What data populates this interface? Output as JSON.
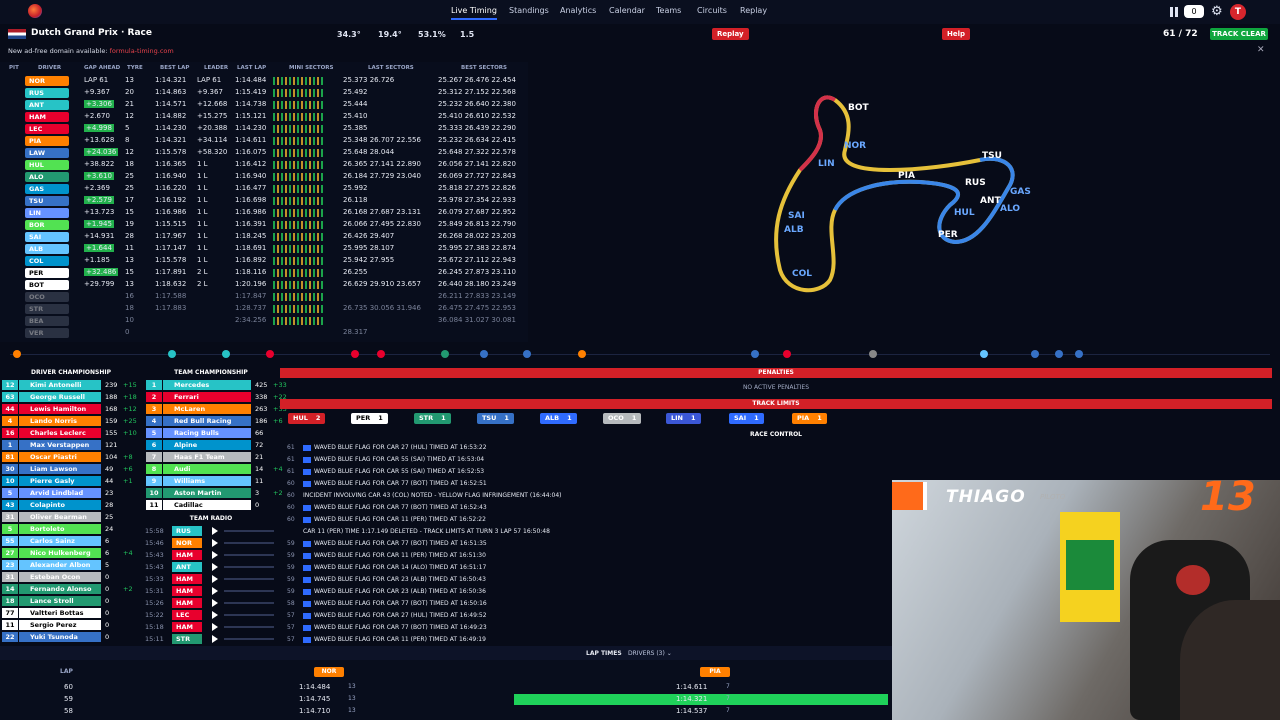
{
  "nav": {
    "items": [
      "Live Timing",
      "Standings",
      "Analytics",
      "Calendar",
      "Teams",
      "Circuits",
      "Replay"
    ],
    "notif_count": "0",
    "avatar_letter": "T"
  },
  "session": {
    "title": "Dutch Grand Prix · Race",
    "track_temp": "34.3°",
    "air_temp": "19.4°",
    "humidity": "53.1%",
    "wind": "1.5",
    "replay_label": "Replay",
    "help_label": "Help",
    "laps": "61 / 72",
    "status": "TRACK CLEAR",
    "ad_notice": "New ad-free domain available:",
    "ad_link": "formula-timing.com"
  },
  "timing_headers": [
    "PIT",
    "DRIVER",
    "GAP AHEAD",
    "TYRE",
    "BEST LAP",
    "LEADER",
    "LAST LAP",
    "MINI SECTORS",
    "LAST SECTORS",
    "BEST SECTORS"
  ],
  "timing_rows": [
    {
      "pos": "1",
      "code": "NOR",
      "color": "#ff8000",
      "gap": "LAP 61",
      "tyre": "13",
      "best": "1:14.321",
      "leader": "LAP 61",
      "last": "1:14.484",
      "ls": "25.373 26.726",
      "bs": "25.267 26.476 22.454"
    },
    {
      "pos": "2",
      "code": "RUS",
      "color": "#27c3c6",
      "gap": "+9.367",
      "tyre": "20",
      "best": "1:14.863",
      "leader": "+9.367",
      "last": "1:15.419",
      "ls": "25.492",
      "bs": "25.312 27.152 22.568"
    },
    {
      "pos": "3",
      "code": "ANT",
      "color": "#27c3c6",
      "gap": "+3.306",
      "tyre": "21",
      "best": "1:14.571",
      "leader": "+12.668",
      "last": "1:14.738",
      "ls": "25.444",
      "bs": "25.232 26.640 22.380"
    },
    {
      "pos": "4",
      "code": "HAM",
      "color": "#e8002d",
      "gap": "+2.670",
      "tyre": "12",
      "best": "1:14.882",
      "leader": "+15.275",
      "last": "1:15.121",
      "ls": "25.410",
      "bs": "25.410 26.610 22.532"
    },
    {
      "pos": "5",
      "code": "LEC",
      "color": "#e8002d",
      "gap": "+4.998",
      "tyre": "5",
      "best": "1:14.230",
      "leader": "+20.388",
      "last": "1:14.230",
      "ls": "25.385",
      "bs": "25.333 26.439 22.290"
    },
    {
      "pos": "6",
      "code": "PIA",
      "color": "#ff8000",
      "gap": "+13.628",
      "tyre": "8",
      "best": "1:14.321",
      "leader": "+34.114",
      "last": "1:14.611",
      "ls": "25.348 26.707 22.556",
      "bs": "25.232 26.634 22.415"
    },
    {
      "pos": "7",
      "code": "LAW",
      "color": "#3671c6",
      "gap": "+24.036",
      "tyre": "12",
      "best": "1:15.578",
      "leader": "+58.320",
      "last": "1:16.075",
      "ls": "25.648 28.044",
      "bs": "25.648 27.322 22.578"
    },
    {
      "pos": "8",
      "code": "HUL",
      "color": "#52e252",
      "gap": "+38.822",
      "tyre": "18",
      "best": "1:16.365",
      "leader": "1 L",
      "last": "1:16.412",
      "ls": "26.365 27.141 22.890",
      "bs": "26.056 27.141 22.820"
    },
    {
      "pos": "9",
      "code": "ALO",
      "color": "#229971",
      "gap": "+3.610",
      "tyre": "25",
      "best": "1:16.940",
      "leader": "1 L",
      "last": "1:16.940",
      "ls": "26.184 27.729 23.040",
      "bs": "26.069 27.727 22.843"
    },
    {
      "pos": "10",
      "code": "GAS",
      "color": "#0093cc",
      "gap": "+2.369",
      "tyre": "25",
      "best": "1:16.220",
      "leader": "1 L",
      "last": "1:16.477",
      "ls": "25.992",
      "bs": "25.818 27.275 22.826"
    },
    {
      "pos": "11",
      "code": "TSU",
      "color": "#3671c6",
      "gap": "+2.579",
      "tyre": "17",
      "best": "1:16.192",
      "leader": "1 L",
      "last": "1:16.698",
      "ls": "26.118",
      "bs": "25.978 27.354 22.933"
    },
    {
      "pos": "12",
      "code": "LIN",
      "color": "#6692ff",
      "gap": "+13.723",
      "tyre": "15",
      "best": "1:16.986",
      "leader": "1 L",
      "last": "1:16.986",
      "ls": "26.168 27.687 23.131",
      "bs": "26.079 27.687 22.952"
    },
    {
      "pos": "13",
      "code": "BOR",
      "color": "#52e252",
      "gap": "+1.945",
      "tyre": "19",
      "best": "1:15.515",
      "leader": "1 L",
      "last": "1:16.391",
      "ls": "26.066 27.495 22.830",
      "bs": "25.849 26.813 22.790"
    },
    {
      "pos": "14",
      "code": "SAI",
      "color": "#64c4ff",
      "gap": "+14.931",
      "tyre": "28",
      "best": "1:17.967",
      "leader": "1 L",
      "last": "1:18.245",
      "ls": "26.426 29.407",
      "bs": "26.268 28.022 23.203"
    },
    {
      "pos": "15",
      "code": "ALB",
      "color": "#64c4ff",
      "gap": "+1.644",
      "tyre": "11",
      "best": "1:17.147",
      "leader": "1 L",
      "last": "1:18.691",
      "ls": "25.995 28.107",
      "bs": "25.995 27.383 22.874"
    },
    {
      "pos": "16",
      "code": "COL",
      "color": "#0093cc",
      "gap": "+1.185",
      "tyre": "13",
      "best": "1:15.578",
      "leader": "1 L",
      "last": "1:16.892",
      "ls": "25.942 27.955",
      "bs": "25.672 27.112 22.943"
    },
    {
      "pos": "17",
      "code": "PER",
      "color": "#ffffff",
      "gap": "+32.486",
      "tyre": "15",
      "best": "1:17.891",
      "leader": "2 L",
      "last": "1:18.116",
      "ls": "26.255",
      "bs": "26.245 27.873 23.110"
    },
    {
      "pos": "18",
      "code": "BOT",
      "color": "#ffffff",
      "gap": "+29.799",
      "tyre": "13",
      "best": "1:18.632",
      "leader": "2 L",
      "last": "1:20.196",
      "ls": "26.629 29.910 23.657",
      "bs": "26.440 28.180 23.249"
    },
    {
      "pos": "19",
      "code": "OCO",
      "color": "#555d72",
      "gap": "",
      "tyre": "16",
      "best": "1:17.588",
      "leader": "",
      "last": "1:17.847",
      "ls": "",
      "bs": "26.211 27.833 23.149"
    },
    {
      "pos": "20",
      "code": "STR",
      "color": "#555d72",
      "gap": "",
      "tyre": "18",
      "best": "1:17.883",
      "leader": "",
      "last": "1:28.737",
      "ls": "26.735 30.056 31.946",
      "bs": "26.475 27.475 22.953"
    },
    {
      "pos": "21",
      "code": "BEA",
      "color": "#555d72",
      "gap": "",
      "tyre": "10",
      "best": "",
      "leader": "",
      "last": "2:34.256",
      "ls": "",
      "bs": "36.084 31.027 30.081"
    },
    {
      "pos": "22",
      "code": "VER",
      "color": "#555d72",
      "gap": "",
      "tyre": "0",
      "best": "",
      "leader": "",
      "last": "",
      "ls": "28.317",
      "bs": ""
    }
  ],
  "map_labels": [
    "BOT",
    "LIN",
    "NOR",
    "TSU",
    "PIA",
    "RUS",
    "GAS",
    "ANT",
    "ALO",
    "SAI",
    "ALB",
    "HUL",
    "PER",
    "COL"
  ],
  "driver_champ": {
    "title": "DRIVER CHAMPIONSHIP",
    "rows": [
      {
        "num": "12",
        "name": "Kimi Antonelli",
        "pts": "239",
        "delta": "+15",
        "color": "#27c3c6"
      },
      {
        "num": "63",
        "name": "George Russell",
        "pts": "188",
        "delta": "+18",
        "color": "#27c3c6"
      },
      {
        "num": "44",
        "name": "Lewis Hamilton",
        "pts": "168",
        "delta": "+12",
        "color": "#e8002d"
      },
      {
        "num": "4",
        "name": "Lando Norris",
        "pts": "159",
        "delta": "+25",
        "color": "#ff8000"
      },
      {
        "num": "16",
        "name": "Charles Leclerc",
        "pts": "155",
        "delta": "+10",
        "color": "#e8002d"
      },
      {
        "num": "1",
        "name": "Max Verstappen",
        "pts": "121",
        "delta": "",
        "color": "#3671c6"
      },
      {
        "num": "81",
        "name": "Oscar Piastri",
        "pts": "104",
        "delta": "+8",
        "color": "#ff8000"
      },
      {
        "num": "30",
        "name": "Liam Lawson",
        "pts": "49",
        "delta": "+6",
        "color": "#3671c6"
      },
      {
        "num": "10",
        "name": "Pierre Gasly",
        "pts": "44",
        "delta": "+1",
        "color": "#0093cc"
      },
      {
        "num": "5",
        "name": "Arvid Lindblad",
        "pts": "23",
        "delta": "",
        "color": "#6692ff"
      },
      {
        "num": "43",
        "name": "Colapinto",
        "pts": "28",
        "delta": "",
        "color": "#0093cc"
      },
      {
        "num": "31",
        "name": "Oliver Bearman",
        "pts": "25",
        "delta": "",
        "color": "#b6babd"
      },
      {
        "num": "5",
        "name": "Bortoleto",
        "pts": "24",
        "delta": "",
        "color": "#52e252"
      },
      {
        "num": "55",
        "name": "Carlos Sainz",
        "pts": "6",
        "delta": "",
        "color": "#64c4ff"
      },
      {
        "num": "27",
        "name": "Nico Hulkenberg",
        "pts": "6",
        "delta": "+4",
        "color": "#52e252"
      },
      {
        "num": "23",
        "name": "Alexander Albon",
        "pts": "5",
        "delta": "",
        "color": "#64c4ff"
      },
      {
        "num": "31",
        "name": "Esteban Ocon",
        "pts": "0",
        "delta": "",
        "color": "#b6babd"
      },
      {
        "num": "14",
        "name": "Fernando Alonso",
        "pts": "0",
        "delta": "+2",
        "color": "#229971"
      },
      {
        "num": "18",
        "name": "Lance Stroll",
        "pts": "0",
        "delta": "",
        "color": "#229971"
      },
      {
        "num": "77",
        "name": "Valtteri Bottas",
        "pts": "0",
        "delta": "",
        "color": "#ffffff"
      },
      {
        "num": "11",
        "name": "Sergio Perez",
        "pts": "0",
        "delta": "",
        "color": "#ffffff"
      },
      {
        "num": "22",
        "name": "Yuki Tsunoda",
        "pts": "0",
        "delta": "",
        "color": "#3671c6"
      }
    ]
  },
  "team_champ": {
    "title": "TEAM CHAMPIONSHIP",
    "rows": [
      {
        "num": "1",
        "name": "Mercedes",
        "pts": "425",
        "delta": "+33",
        "color": "#27c3c6"
      },
      {
        "num": "2",
        "name": "Ferrari",
        "pts": "338",
        "delta": "+22",
        "color": "#e8002d"
      },
      {
        "num": "3",
        "name": "McLaren",
        "pts": "263",
        "delta": "+33",
        "color": "#ff8000"
      },
      {
        "num": "4",
        "name": "Red Bull Racing",
        "pts": "186",
        "delta": "+6",
        "color": "#3671c6"
      },
      {
        "num": "5",
        "name": "Racing Bulls",
        "pts": "66",
        "delta": "",
        "color": "#6692ff"
      },
      {
        "num": "6",
        "name": "Alpine",
        "pts": "72",
        "delta": "",
        "color": "#0093cc"
      },
      {
        "num": "7",
        "name": "Haas F1 Team",
        "pts": "21",
        "delta": "",
        "color": "#b6babd"
      },
      {
        "num": "8",
        "name": "Audi",
        "pts": "14",
        "delta": "+4",
        "color": "#52e252"
      },
      {
        "num": "9",
        "name": "Williams",
        "pts": "11",
        "delta": "",
        "color": "#64c4ff"
      },
      {
        "num": "10",
        "name": "Aston Martin",
        "pts": "3",
        "delta": "+2",
        "color": "#229971"
      },
      {
        "num": "11",
        "name": "Cadillac",
        "pts": "0",
        "delta": "",
        "color": "#ffffff"
      }
    ]
  },
  "team_radio": {
    "title": "TEAM RADIO",
    "rows": [
      {
        "time": "15:58",
        "driver": "RUS",
        "color": "#27c3c6"
      },
      {
        "time": "15:46",
        "driver": "NOR",
        "color": "#ff8000"
      },
      {
        "time": "15:43",
        "driver": "HAM",
        "color": "#e8002d"
      },
      {
        "time": "15:43",
        "driver": "ANT",
        "color": "#27c3c6"
      },
      {
        "time": "15:33",
        "driver": "HAM",
        "color": "#e8002d"
      },
      {
        "time": "15:31",
        "driver": "HAM",
        "color": "#e8002d"
      },
      {
        "time": "15:26",
        "driver": "HAM",
        "color": "#e8002d"
      },
      {
        "time": "15:22",
        "driver": "LEC",
        "color": "#e8002d"
      },
      {
        "time": "15:18",
        "driver": "HAM",
        "color": "#e8002d"
      },
      {
        "time": "15:11",
        "driver": "STR",
        "color": "#229971"
      }
    ]
  },
  "penalties": {
    "title": "PENALTIES",
    "empty": "NO ACTIVE PENALTIES"
  },
  "track_limits": {
    "title": "TRACK LIMITS",
    "chips": [
      {
        "code": "HUL",
        "count": "2",
        "color": "#d32027"
      },
      {
        "code": "PER",
        "count": "1",
        "color": "#ffffff"
      },
      {
        "code": "STR",
        "count": "1",
        "color": "#229971"
      },
      {
        "code": "TSU",
        "count": "1",
        "color": "#3671c6"
      },
      {
        "code": "ALB",
        "count": "1",
        "color": "#2f6bff"
      },
      {
        "code": "OCO",
        "count": "1",
        "color": "#b6babd"
      },
      {
        "code": "LIN",
        "count": "1",
        "color": "#3b57d6"
      },
      {
        "code": "SAI",
        "count": "1",
        "color": "#2f6bff"
      },
      {
        "code": "PIA",
        "count": "1",
        "color": "#ff8000"
      }
    ]
  },
  "race_control": {
    "title": "RACE CONTROL",
    "rows": [
      {
        "lap": "61",
        "msg": "WAVED BLUE FLAG FOR CAR 27 (HUL) TIMED AT 16:53:22"
      },
      {
        "lap": "61",
        "msg": "WAVED BLUE FLAG FOR CAR 55 (SAI) TIMED AT 16:53:04"
      },
      {
        "lap": "61",
        "msg": "WAVED BLUE FLAG FOR CAR 55 (SAI) TIMED AT 16:52:53"
      },
      {
        "lap": "60",
        "msg": "WAVED BLUE FLAG FOR CAR 77 (BOT) TIMED AT 16:52:51"
      },
      {
        "lap": "60",
        "msg": "INCIDENT INVOLVING CAR 43 (COL) NOTED - YELLOW FLAG INFRINGEMENT (16:44:04)"
      },
      {
        "lap": "60",
        "msg": "WAVED BLUE FLAG FOR CAR 77 (BOT) TIMED AT 16:52:43"
      },
      {
        "lap": "60",
        "msg": "WAVED BLUE FLAG FOR CAR 11 (PER) TIMED AT 16:52:22"
      },
      {
        "lap": "",
        "msg": "CAR 11 (PER) TIME 1:17.149 DELETED - TRACK LIMITS AT TURN 3 LAP 57 16:50:48"
      },
      {
        "lap": "59",
        "msg": "WAVED BLUE FLAG FOR CAR 77 (BOT) TIMED AT 16:51:35"
      },
      {
        "lap": "59",
        "msg": "WAVED BLUE FLAG FOR CAR 11 (PER) TIMED AT 16:51:30"
      },
      {
        "lap": "59",
        "msg": "WAVED BLUE FLAG FOR CAR 14 (ALO) TIMED AT 16:51:17"
      },
      {
        "lap": "59",
        "msg": "WAVED BLUE FLAG FOR CAR 23 (ALB) TIMED AT 16:50:43"
      },
      {
        "lap": "59",
        "msg": "WAVED BLUE FLAG FOR CAR 23 (ALB) TIMED AT 16:50:36"
      },
      {
        "lap": "58",
        "msg": "WAVED BLUE FLAG FOR CAR 77 (BOT) TIMED AT 16:50:16"
      },
      {
        "lap": "57",
        "msg": "WAVED BLUE FLAG FOR CAR 27 (HUL) TIMED AT 16:49:52"
      },
      {
        "lap": "57",
        "msg": "WAVED BLUE FLAG FOR CAR 77 (BOT) TIMED AT 16:49:23"
      },
      {
        "lap": "57",
        "msg": "WAVED BLUE FLAG FOR CAR 11 (PER) TIMED AT 16:49:19"
      }
    ]
  },
  "lap_times": {
    "title": "LAP TIMES",
    "drivers_label": "DRIVERS (3)",
    "lap_header": "LAP",
    "col1": "NOR",
    "col2": "PIA",
    "rows": [
      {
        "lap": "60",
        "a": "1:14.484",
        "an": "13",
        "b": "1:14.611",
        "bn": "7"
      },
      {
        "lap": "59",
        "a": "1:14.745",
        "an": "13",
        "b": "1:14.321",
        "bn": "7"
      },
      {
        "lap": "58",
        "a": "1:14.710",
        "an": "13",
        "b": "1:14.537",
        "bn": "7"
      }
    ]
  },
  "webcam": {
    "name": "THIAGO",
    "role": "PILOTO",
    "number": "13"
  }
}
